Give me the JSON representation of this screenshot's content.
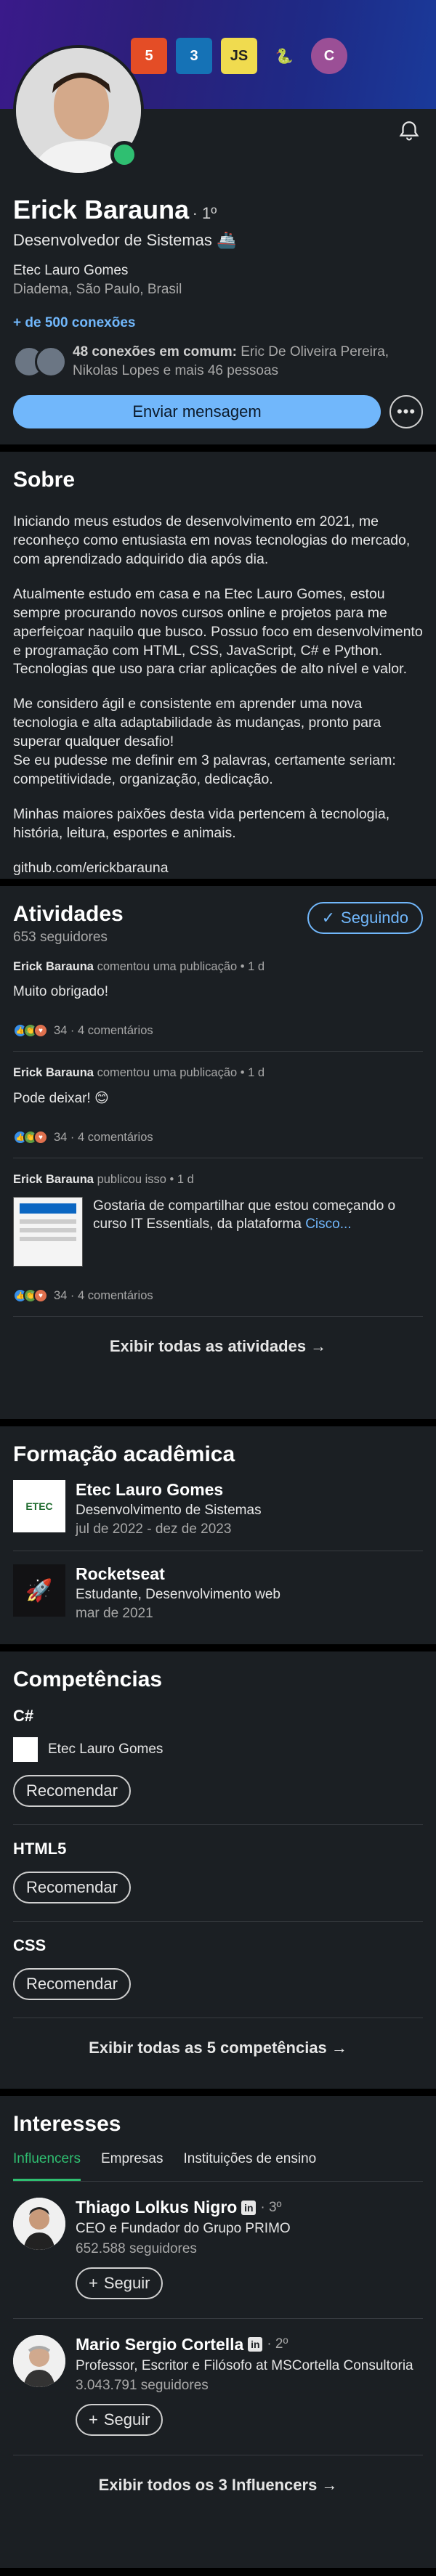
{
  "profile": {
    "name": "Erick Barauna",
    "degree": "· 1º",
    "headline": "Desenvolvedor de Sistemas 🚢",
    "company": "Etec Lauro Gomes",
    "location": "Diadema, São Paulo, Brasil",
    "connections": "+ de 500 conexões",
    "mutual_bold": "48 conexões em comum:",
    "mutual_rest": "Eric De Oliveira Pereira, Nikolas Lopes e mais 46 pessoas",
    "message_button": "Enviar mensagem",
    "more_button": "•••"
  },
  "banner": {
    "icons": [
      {
        "label": "5",
        "color": "#e44d26"
      },
      {
        "label": "3",
        "color": "#1572b6"
      },
      {
        "label": "JS",
        "color": "#f0db4f"
      },
      {
        "label": "🐍",
        "color": "#3776ab"
      },
      {
        "label": "C",
        "color": "#9b4f96"
      }
    ]
  },
  "about": {
    "title": "Sobre",
    "p1": "Iniciando meus estudos de desenvolvimento em 2021, me reconheço como entusiasta em novas tecnologias do mercado, com aprendizado adquirido dia após dia.",
    "p2": "Atualmente estudo em casa e na Etec Lauro Gomes, estou sempre procurando novos cursos online e projetos para me aperfeiçoar naquilo que busco. Possuo foco em desenvolvimento e programação com HTML, CSS, JavaScript, C# e Python. Tecnologias que uso para criar aplicações de alto nível e valor.",
    "p3": "Me considero ágil e consistente em aprender uma nova tecnologia e alta adaptabilidade às mudanças, pronto para superar qualquer desafio!\nSe eu pudesse me definir em 3 palavras, certamente seriam: competitividade, organização, dedicação.",
    "p4": "Minhas maiores paixões desta vida pertencem à tecnologia, história, leitura, esportes e animais.",
    "link": "github.com/erickbarauna"
  },
  "activity": {
    "title": "Atividades",
    "followers": "653 seguidores",
    "follow_button": "Seguindo",
    "posts": [
      {
        "author": "Erick Barauna",
        "action": "comentou uma publicação • 1 d",
        "text": "Muito obrigado!",
        "reactions": "34 · 4 comentários"
      },
      {
        "author": "Erick Barauna",
        "action": "comentou uma publicação • 1 d",
        "text": "Pode deixar! 😊",
        "reactions": "34 · 4 comentários"
      },
      {
        "author": "Erick Barauna",
        "action": "publicou isso • 1 d",
        "text": "Gostaria de compartilhar que estou começando o curso IT Essentials, da plataforma",
        "link": "Cisco...",
        "reactions": "34 · 4 comentários"
      }
    ],
    "show_all": "Exibir todas as atividades →"
  },
  "education": {
    "title": "Formação acadêmica",
    "items": [
      {
        "school": "Etec Lauro Gomes",
        "degree": "Desenvolvimento de Sistemas",
        "dates": "jul de 2022 - dez de 2023",
        "logo_text": "ETEC"
      },
      {
        "school": "Rocketseat",
        "degree": "Estudante, Desenvolvimento web",
        "dates": "mar de 2021",
        "logo_text": "🚀"
      }
    ]
  },
  "skills": {
    "title": "Competências",
    "items": [
      {
        "name": "C#",
        "endorsement": "Etec Lauro Gomes",
        "button": "Recomendar"
      },
      {
        "name": "HTML5",
        "button": "Recomendar"
      },
      {
        "name": "CSS",
        "button": "Recomendar"
      }
    ],
    "show_all": "Exibir todas as 5 competências →"
  },
  "interests": {
    "title": "Interesses",
    "tabs": [
      "Influencers",
      "Empresas",
      "Instituições de ensino"
    ],
    "items": [
      {
        "name": "Thiago Lolkus Nigro",
        "degree": "· 3º",
        "headline": "CEO e Fundador do Grupo PRIMO",
        "followers": "652.588 seguidores",
        "button": "Seguir"
      },
      {
        "name": "Mario Sergio Cortella",
        "degree": "· 2º",
        "headline": "Professor, Escritor e Filósofo at MSCortella Consultoria",
        "followers": "3.043.791 seguidores",
        "button": "Seguir"
      }
    ],
    "show_all": "Exibir todos os 3 Influencers →"
  }
}
